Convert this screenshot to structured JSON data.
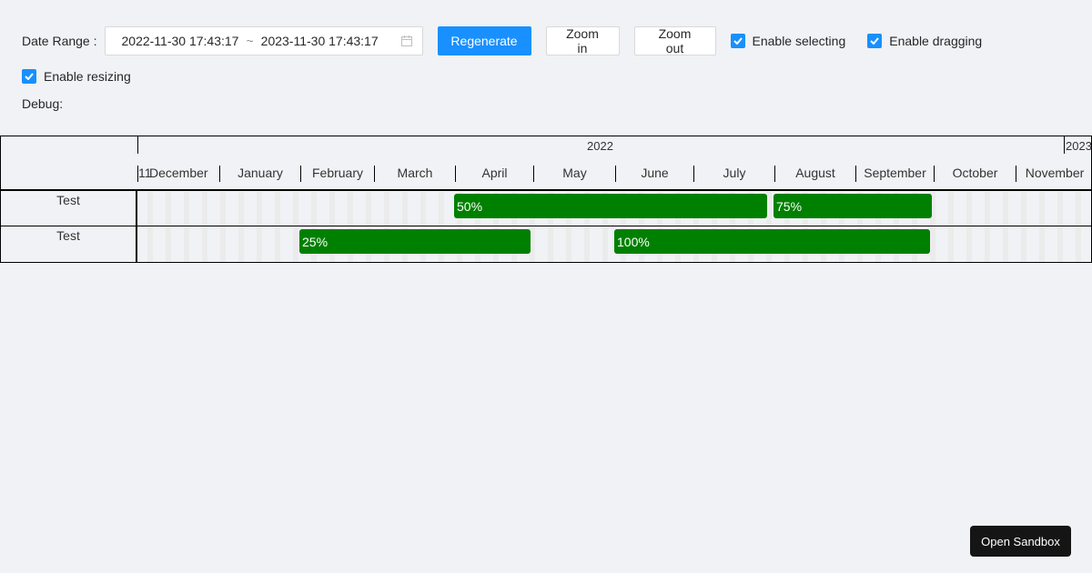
{
  "controls": {
    "date_range_label": "Date Range",
    "date_range_colon": ":",
    "range_start": "2022-11-30 17:43:17",
    "range_sep": "~",
    "range_end": "2023-11-30 17:43:17",
    "regenerate_label": "Regenerate",
    "zoom_in_label": "Zoom in",
    "zoom_out_label": "Zoom out",
    "enable_selecting_label": "Enable selecting",
    "enable_selecting_checked": true,
    "enable_dragging_label": "Enable dragging",
    "enable_dragging_checked": true,
    "enable_resizing_label": "Enable resizing",
    "enable_resizing_checked": true,
    "debug_label": "Debug:"
  },
  "gantt": {
    "years": [
      "2022",
      "2023"
    ],
    "months": [
      "11",
      "December",
      "January",
      "February",
      "March",
      "April",
      "May",
      "June",
      "July",
      "August",
      "September",
      "October",
      "November"
    ],
    "rows": [
      {
        "label": "Test",
        "tasks": [
          {
            "label": "50%"
          },
          {
            "label": "75%"
          }
        ]
      },
      {
        "label": "Test",
        "tasks": [
          {
            "label": "25%"
          },
          {
            "label": "100%"
          }
        ]
      }
    ],
    "bar_color": "#008000"
  },
  "sandbox_label": "Open Sandbox",
  "colors": {
    "primary": "#1890ff",
    "background": "#f0f2f5"
  }
}
